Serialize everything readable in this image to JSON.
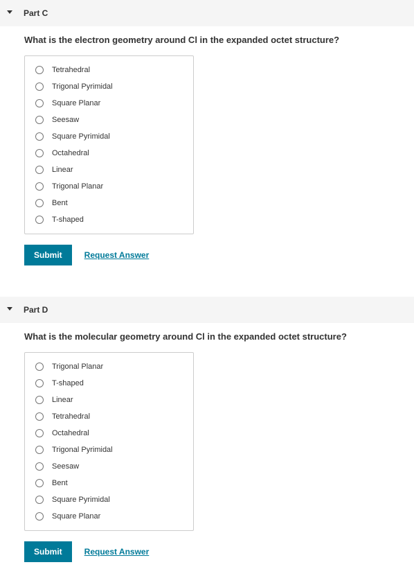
{
  "parts": [
    {
      "label": "Part C",
      "question": "What is the electron geometry around Cl in the expanded octet structure?",
      "options": [
        "Tetrahedral",
        "Trigonal Pyrimidal",
        "Square Planar",
        "Seesaw",
        "Square Pyrimidal",
        "Octahedral",
        "Linear",
        "Trigonal Planar",
        "Bent",
        "T-shaped"
      ],
      "submit_label": "Submit",
      "request_label": "Request Answer"
    },
    {
      "label": "Part D",
      "question": "What is the molecular geometry around Cl in the expanded octet structure?",
      "options": [
        "Trigonal Planar",
        "T-shaped",
        "Linear",
        "Tetrahedral",
        "Octahedral",
        "Trigonal Pyrimidal",
        "Seesaw",
        "Bent",
        "Square Pyrimidal",
        "Square Planar"
      ],
      "submit_label": "Submit",
      "request_label": "Request Answer"
    }
  ]
}
